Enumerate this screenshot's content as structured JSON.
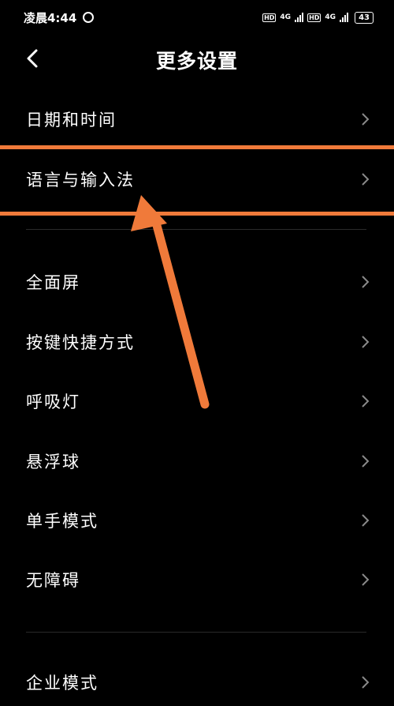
{
  "status": {
    "time": "凌晨4:44",
    "network1": "4G",
    "network2": "4G",
    "hd": "HD",
    "battery": "43"
  },
  "header": {
    "title": "更多设置"
  },
  "items": [
    {
      "label": "日期和时间"
    },
    {
      "label": "语言与输入法"
    },
    {
      "label": "全面屏"
    },
    {
      "label": "按键快捷方式"
    },
    {
      "label": "呼吸灯"
    },
    {
      "label": "悬浮球"
    },
    {
      "label": "单手模式"
    },
    {
      "label": "无障碍"
    },
    {
      "label": "企业模式"
    }
  ],
  "colors": {
    "background": "#000000",
    "annotation": "#f07a3a",
    "chevron": "#8a8a8a"
  }
}
